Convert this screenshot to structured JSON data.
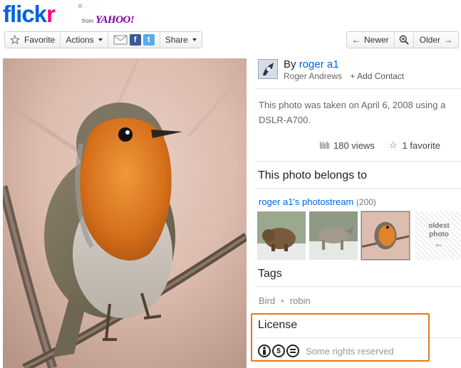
{
  "brand": {
    "name_part1": "flick",
    "name_part2": "r",
    "registered": "®",
    "from": "from",
    "partner": "YAHOO!"
  },
  "toolbar": {
    "favorite_label": "Favorite",
    "actions_label": "Actions",
    "share_label": "Share",
    "share_icons": [
      "email-icon",
      "facebook-icon",
      "twitter-icon"
    ],
    "newer_label": "Newer",
    "older_label": "Older",
    "zoom_icon": "zoom-icon"
  },
  "owner": {
    "by_prefix": "By",
    "username": "roger a1",
    "real_name": "Roger Andrews",
    "add_contact": "+ Add Contact"
  },
  "photo_info": {
    "description_line1": "This photo was taken on April 6, 2008 using a",
    "description_line2": "DSLR-A700.",
    "views": "180 views",
    "favorites": "1 favorite"
  },
  "belongs": {
    "title": "This photo belongs to",
    "photostream_label": "roger a1's photostream",
    "photostream_count": "(200)",
    "thumbnails": [
      "bear",
      "wolf",
      "robin"
    ],
    "oldest_line1": "oldest",
    "oldest_line2": "photo",
    "oldest_arrow": "←"
  },
  "tags": {
    "title": "Tags",
    "items": [
      "Bird",
      "robin"
    ],
    "separator": "•"
  },
  "license": {
    "title": "License",
    "icons": [
      "cc-by-icon",
      "cc-nc-icon",
      "cc-nd-icon"
    ],
    "text": "Some rights reserved"
  },
  "colors": {
    "link": "#0063dc",
    "brand_pink": "#ff0084",
    "highlight": "#e07b1a"
  }
}
